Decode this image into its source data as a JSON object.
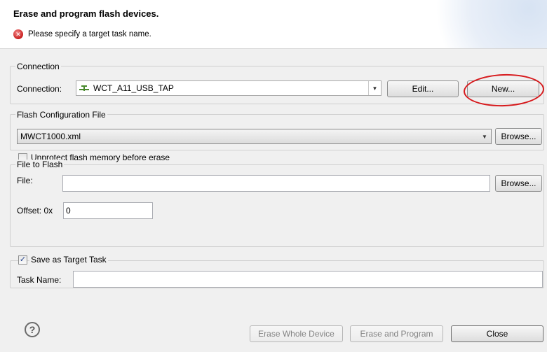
{
  "header": {
    "title": "Erase and program flash devices.",
    "message": "Please specify a target task name."
  },
  "connection_group": {
    "label": "Connection",
    "field_label": "Connection:",
    "selected": "WCT_A11_USB_TAP",
    "edit_label": "Edit...",
    "new_label": "New..."
  },
  "flash_config_group": {
    "label": "Flash Configuration File",
    "selected": "MWCT1000.xml",
    "browse_label": "Browse...",
    "unprotect_label": "Unprotect flash memory before erase",
    "unprotect_checked": false
  },
  "file_group": {
    "label": "File to Flash",
    "file_label": "File:",
    "file_value": "",
    "browse_label": "Browse...",
    "offset_label": "Offset: 0x",
    "offset_value": "0"
  },
  "target_task_group": {
    "save_label": "Save as Target Task",
    "save_checked": true,
    "task_name_label": "Task Name:",
    "task_name_value": ""
  },
  "footer": {
    "erase_whole_label": "Erase Whole Device",
    "erase_program_label": "Erase and Program",
    "close_label": "Close"
  },
  "icons": {
    "error": "error-icon",
    "connection": "connection-icon",
    "help": "help-icon",
    "dropdown": "chevron-down-icon",
    "checkbox_checked": "checkmark-icon"
  },
  "colors": {
    "highlight_ellipse": "#d7191c",
    "error_icon": "#c81e1e",
    "connection_icon": "#4a8a2e"
  }
}
